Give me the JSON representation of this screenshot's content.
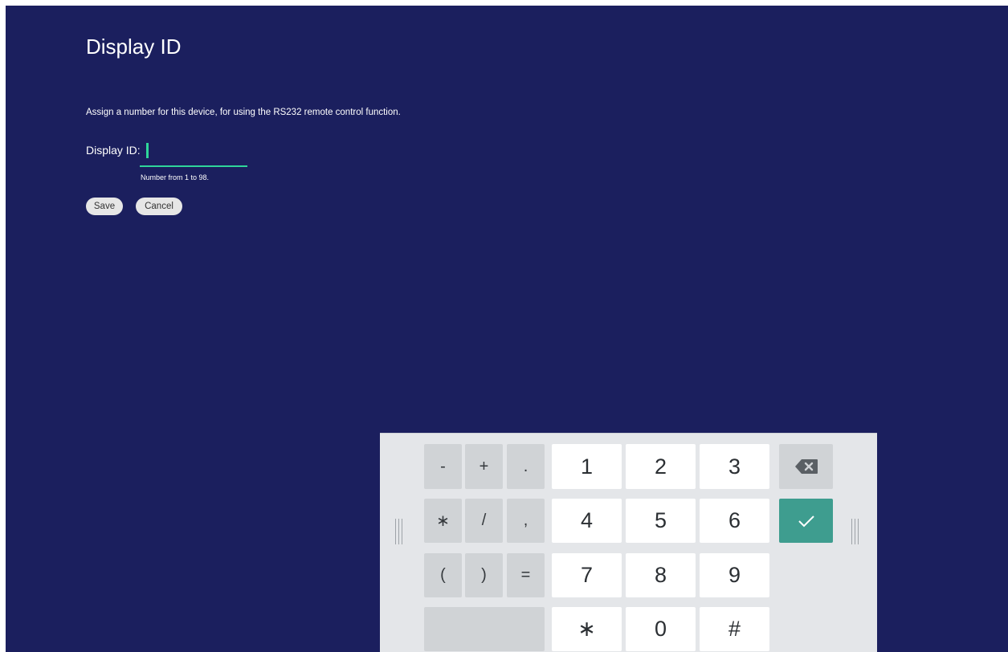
{
  "page": {
    "title": "Display ID",
    "description": "Assign a number for this device, for using the RS232 remote control function.",
    "field_label": "Display ID:",
    "field_value": "",
    "hint": "Number from 1 to 98.",
    "save_label": "Save",
    "cancel_label": "Cancel"
  },
  "keyboard": {
    "symbols": [
      "-",
      "+",
      ".",
      "∗",
      "/",
      ",",
      "(",
      ")",
      "="
    ],
    "digits": [
      "1",
      "2",
      "3",
      "4",
      "5",
      "6",
      "7",
      "8",
      "9"
    ],
    "bottom": [
      "∗",
      "0",
      "#"
    ],
    "backspace_icon": "backspace-icon",
    "enter_icon": "checkmark-icon"
  },
  "colors": {
    "background": "#1b1f5e",
    "accent": "#2fd69a",
    "enter_key": "#3e9d8f"
  }
}
